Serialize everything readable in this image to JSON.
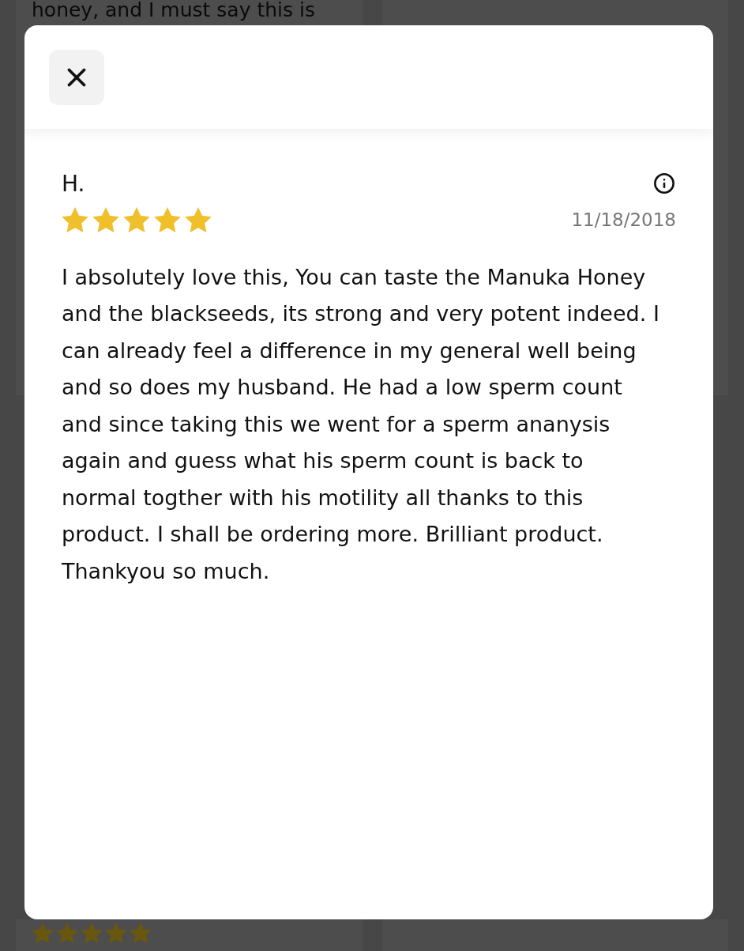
{
  "background": {
    "upper_card": {
      "text": "honey, and I must say this is"
    },
    "lower_card": {
      "stars": 5
    }
  },
  "modal": {
    "review": {
      "author": "H.",
      "stars": 5,
      "date": "11/18/2018",
      "text": "I absolutely love this, You can taste the Manuka Honey and the blackseeds, its strong and very potent indeed. I can already feel a difference in my general well being and so does my husband. He had a low sperm count and since taking this we went for a sperm ananysis again and guess what his sperm count is back to normal togther with his motility all thanks to this product. I shall be ordering more. Brilliant product. Thankyou so much."
    }
  }
}
